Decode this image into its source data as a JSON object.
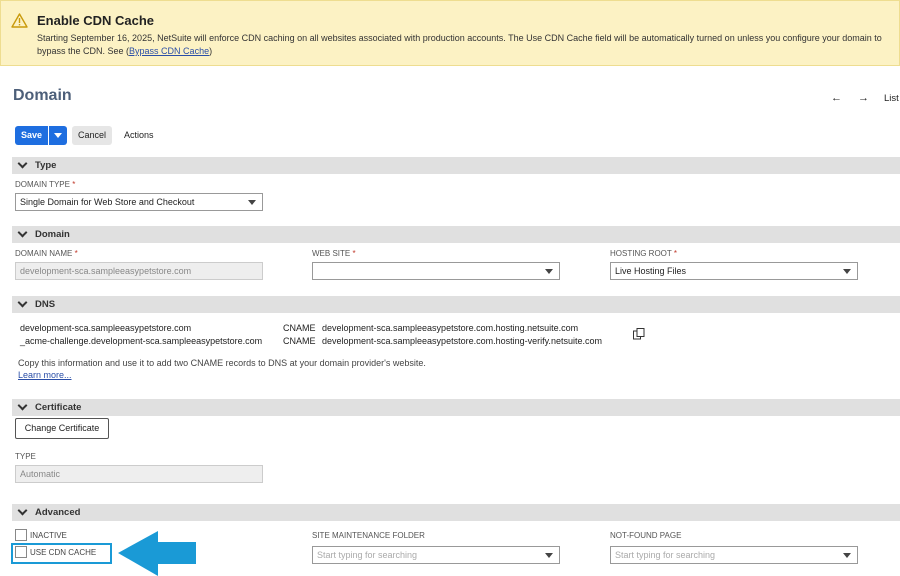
{
  "banner": {
    "title": "Enable CDN Cache",
    "text": "Starting September 16, 2025, NetSuite will enforce CDN caching on all websites associated with production accounts. The Use CDN Cache field will be automatically turned on unless you configure your domain to bypass the CDN. See (",
    "link": "Bypass CDN Cache",
    "text_end": ")",
    "icon": "warning-icon"
  },
  "page": {
    "title": "Domain"
  },
  "nav": {
    "back": "←",
    "forward": "→",
    "list": "List"
  },
  "toolbar": {
    "save": "Save",
    "cancel": "Cancel",
    "actions": "Actions"
  },
  "sections": {
    "type": {
      "title": "Type",
      "domain_type_label": "DOMAIN TYPE",
      "domain_type_value": "Single Domain for Web Store and Checkout"
    },
    "domain": {
      "title": "Domain",
      "domain_name_label": "DOMAIN NAME",
      "domain_name_value": "development-sca.sampleeasypetstore.com",
      "web_site_label": "WEB SITE",
      "web_site_value": "",
      "hosting_root_label": "HOSTING ROOT",
      "hosting_root_value": "Live Hosting Files"
    },
    "dns": {
      "title": "DNS",
      "records": [
        {
          "host": "development-sca.sampleeasypetstore.com",
          "type": "CNAME",
          "target": "development-sca.sampleeasypetstore.com.hosting.netsuite.com"
        },
        {
          "host": "_acme-challenge.development-sca.sampleeasypetstore.com",
          "type": "CNAME",
          "target": "development-sca.sampleeasypetstore.com.hosting-verify.netsuite.com"
        }
      ],
      "note": "Copy this information and use it to add two CNAME records to DNS at your domain provider's website.",
      "learn_more": "Learn more..."
    },
    "certificate": {
      "title": "Certificate",
      "change_button": "Change Certificate",
      "type_label": "TYPE",
      "type_value": "Automatic"
    },
    "advanced": {
      "title": "Advanced",
      "inactive_label": "INACTIVE",
      "use_cdn_label": "USE CDN CACHE",
      "maintenance_label": "SITE MAINTENANCE FOLDER",
      "maintenance_placeholder": "Start typing for searching",
      "notfound_label": "NOT-FOUND PAGE",
      "notfound_placeholder": "Start typing for searching"
    }
  },
  "required_marker": "*",
  "colors": {
    "accent": "#1e6ee0",
    "banner_bg": "#fcf2c4",
    "annotation": "#1a9ad6"
  }
}
